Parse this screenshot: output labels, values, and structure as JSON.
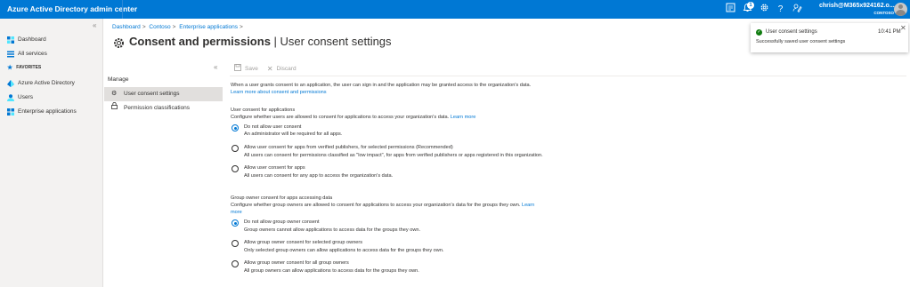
{
  "topbar": {
    "title": "Azure Active Directory admin center",
    "notification_count": "1",
    "user_name": "chrish@M365x924162.o...",
    "tenant": "CONTOSO",
    "icons": [
      "portal-feedback-icon",
      "notifications-icon",
      "settings-icon",
      "help-icon",
      "feedback-icon"
    ]
  },
  "leftnav": {
    "items": [
      {
        "label": "Dashboard",
        "icon": "dashboard-icon"
      },
      {
        "label": "All services",
        "icon": "list-icon"
      }
    ],
    "favorites_label": "FAVORITES",
    "favorites": [
      {
        "label": "Azure Active Directory",
        "icon": "aad-icon"
      },
      {
        "label": "Users",
        "icon": "users-icon"
      },
      {
        "label": "Enterprise applications",
        "icon": "apps-icon"
      }
    ]
  },
  "breadcrumb": [
    "Dashboard",
    "Contoso",
    "Enterprise applications"
  ],
  "page": {
    "title_main": "Consent and permissions",
    "title_sep": " | ",
    "title_sub": "User consent settings",
    "more": "···"
  },
  "menu": {
    "section": "Manage",
    "items": [
      {
        "label": "User consent settings",
        "active": true
      },
      {
        "label": "Permission classifications",
        "active": false
      }
    ]
  },
  "toolbar": {
    "save": "Save",
    "discard": "Discard"
  },
  "content": {
    "intro": "When a user grants consent to an application, the user can sign in and the application may be granted access to the organization's data.",
    "intro_link": "Learn more about consent and permissions",
    "user_section": {
      "heading": "User consent for applications",
      "desc": "Configure whether users are allowed to consent for applications to access your organization's data.",
      "link": "Learn more",
      "options": [
        {
          "label": "Do not allow user consent",
          "desc": "An administrator will be required for all apps.",
          "selected": true
        },
        {
          "label": "Allow user consent for apps from verified publishers, for selected permissions (Recommended)",
          "desc": "All users can consent for permissions classified as \"low impact\", for apps from verified publishers or apps registered in this organization.",
          "selected": false
        },
        {
          "label": "Allow user consent for apps",
          "desc": "All users can consent for any app to access the organization's data.",
          "selected": false
        }
      ]
    },
    "group_section": {
      "heading": "Group owner consent for apps accessing data",
      "desc": "Configure whether group owners are allowed to consent for applications to access your organization's data for the groups they own.",
      "link_part1": "Learn",
      "link_part2": "more",
      "options": [
        {
          "label": "Do not allow group owner consent",
          "desc": "Group owners cannot allow applications to access data for the groups they own.",
          "selected": true
        },
        {
          "label": "Allow group owner consent for selected group owners",
          "desc": "Only selected group owners can allow applications to access data for the groups they own.",
          "selected": false
        },
        {
          "label": "Allow group owner consent for all group owners",
          "desc": "All group owners can allow applications to access data for the groups they own.",
          "selected": false
        }
      ]
    }
  },
  "toast": {
    "title": "User consent settings",
    "time": "10:41 PM",
    "message": "Successfully saved user consent settings"
  },
  "colors": {
    "brand": "#0078d4",
    "success": "#107c10",
    "nav_bg": "#f3f2f1"
  }
}
